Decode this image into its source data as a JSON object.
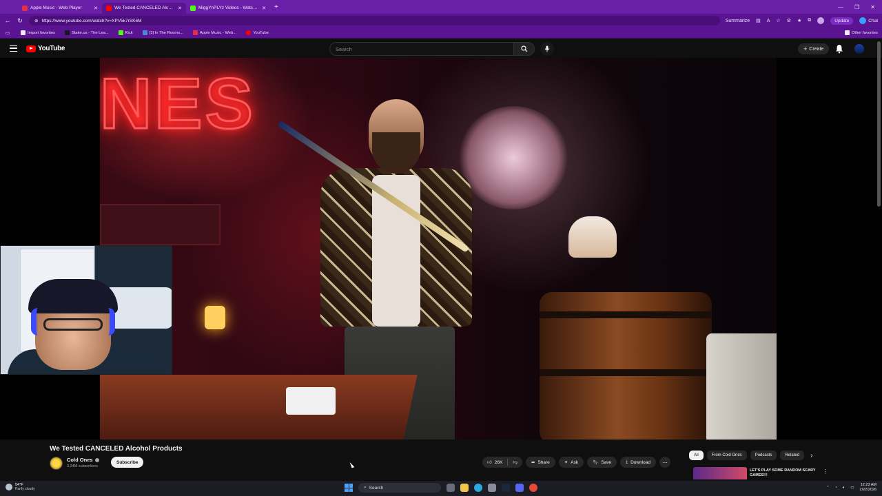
{
  "browser": {
    "tabs": [
      {
        "title": "Apple Music - Web Player",
        "color": "#e2304a",
        "active": false
      },
      {
        "title": "We Tested CANCELED Alcoho",
        "color": "#ff0000",
        "active": true
      },
      {
        "title": "MiggYnPLYz Videos - Watch On-D",
        "color": "#53fc18",
        "active": false
      }
    ],
    "url": "https://www.youtube.com/watch?v=XPV5k7rSK6M",
    "summarize_label": "Summarize",
    "update_label": "Update",
    "chat_label": "Chat",
    "bookmarks": [
      {
        "label": "Import favorites",
        "icon": "folder-icon",
        "color": "#f1e6ff"
      },
      {
        "label": "Stake.us - The Lea...",
        "icon": "stake-icon",
        "color": "#1a1a1a"
      },
      {
        "label": "Kick",
        "icon": "kick-icon",
        "color": "#53fc18"
      },
      {
        "label": "[3] In The Rooms...",
        "icon": "page-icon",
        "color": "#4a8ad8"
      },
      {
        "label": "Apple Music - Web...",
        "icon": "apple-music-icon",
        "color": "#e2304a"
      },
      {
        "label": "YouTube",
        "icon": "youtube-icon",
        "color": "#ff0000"
      }
    ],
    "other_favorites": "Other favorites"
  },
  "youtube": {
    "logo_text": "YouTube",
    "search_placeholder": "Search",
    "create_label": "Create",
    "video": {
      "title": "We Tested CANCELED Alcohol Products",
      "channel": "Cold Ones",
      "subscribers": "3.24M subscribers",
      "subscribe_label": "Subscribe",
      "likes": "26K",
      "share_label": "Share",
      "ask_label": "Ask",
      "save_label": "Save",
      "download_label": "Download"
    },
    "chips": [
      "All",
      "From Cold Ones",
      "Podcasts",
      "Related"
    ],
    "recommendation": {
      "title": "LET'S PLAY SOME RANDOM SCARY GAMES!!!"
    }
  },
  "taskbar": {
    "temperature": "54°F",
    "weather": "Partly cloudy",
    "search_label": "Search",
    "time": "12:23 AM",
    "date": "2/22/2026"
  },
  "colors": {
    "browser_accent": "#6a1fa8",
    "youtube_red": "#ff0000",
    "page_bg": "#0f0f0f"
  }
}
